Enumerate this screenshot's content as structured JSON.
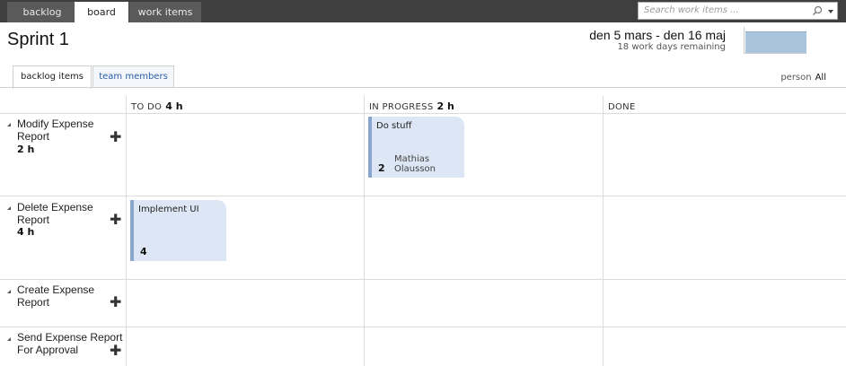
{
  "nav": {
    "tabs": [
      "backlog",
      "board",
      "work items"
    ],
    "active": "board"
  },
  "search": {
    "placeholder": "Search work items ..."
  },
  "sprint": {
    "title": "Sprint 1",
    "dates": "den 5 mars - den 16 maj",
    "remaining": "18 work days remaining",
    "burndown_remaining_fraction": 0.9
  },
  "subtabs": [
    "backlog items",
    "team members"
  ],
  "filter": {
    "label": "person",
    "value": "All"
  },
  "columns": [
    {
      "name": "TO DO",
      "hours": "4 h"
    },
    {
      "name": "IN PROGRESS",
      "hours": "2 h"
    },
    {
      "name": "DONE",
      "hours": ""
    }
  ],
  "rows": [
    {
      "title": "Modify Expense Report",
      "hours": "2 h"
    },
    {
      "title": "Delete Expense Report",
      "hours": "4 h"
    },
    {
      "title": "Create Expense Report",
      "hours": ""
    },
    {
      "title": "Send Expense Report For Approval",
      "hours": ""
    }
  ],
  "cards": [
    {
      "title": "Do stuff",
      "hours": "2",
      "owner": "Mathias Olausson",
      "row": 0,
      "column": 1
    },
    {
      "title": "Implement UI",
      "hours": "4",
      "owner": "",
      "row": 1,
      "column": 0
    }
  ],
  "colors": {
    "topbar": "#3f3f3f",
    "card": "#dde6f4",
    "card_accent": "#8aa6cc",
    "link": "#2a5ea8"
  }
}
